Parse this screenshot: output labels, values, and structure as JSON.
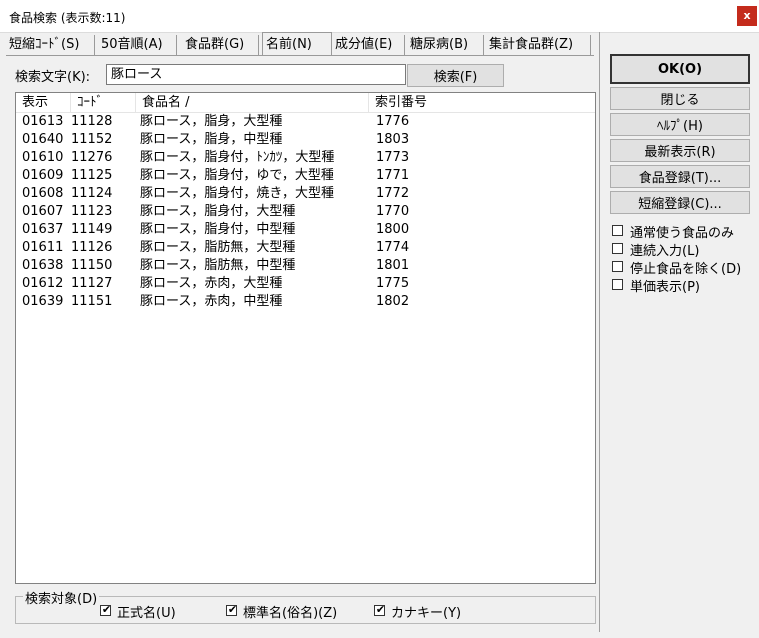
{
  "window": {
    "title": "食品検索 (表示数:11)",
    "close_glyph": "x"
  },
  "tabs": [
    {
      "label": "短縮ｺｰﾄﾞ(S)"
    },
    {
      "label": "50音順(A)"
    },
    {
      "label": "食品群(G)"
    },
    {
      "label": "名前(N)"
    },
    {
      "label": "成分値(E)"
    },
    {
      "label": "糖尿病(B)"
    },
    {
      "label": "集計食品群(Z)"
    }
  ],
  "active_tab": "名前(N)",
  "search": {
    "label": "検索文字(K):",
    "value": "豚ロース",
    "button_label": "検索(F)"
  },
  "table": {
    "columns": [
      "表示",
      "ｺｰﾄﾞ",
      "食品名 /",
      "索引番号"
    ],
    "rows": [
      [
        "01613",
        "11128",
        "豚ロース，脂身，大型種",
        "1776"
      ],
      [
        "01640",
        "11152",
        "豚ロース，脂身，中型種",
        "1803"
      ],
      [
        "01610",
        "11276",
        "豚ロース，脂身付，ﾄﾝｶﾂ，大型種",
        "1773"
      ],
      [
        "01609",
        "11125",
        "豚ロース，脂身付，ゆで，大型種",
        "1771"
      ],
      [
        "01608",
        "11124",
        "豚ロース，脂身付，焼き，大型種",
        "1772"
      ],
      [
        "01607",
        "11123",
        "豚ロース，脂身付，大型種",
        "1770"
      ],
      [
        "01637",
        "11149",
        "豚ロース，脂身付，中型種",
        "1800"
      ],
      [
        "01611",
        "11126",
        "豚ロース，脂肪無，大型種",
        "1774"
      ],
      [
        "01638",
        "11150",
        "豚ロース，脂肪無，中型種",
        "1801"
      ],
      [
        "01612",
        "11127",
        "豚ロース，赤肉，大型種",
        "1775"
      ],
      [
        "01639",
        "11151",
        "豚ロース，赤肉，中型種",
        "1802"
      ]
    ]
  },
  "search_target": {
    "legend": "検索対象(D)",
    "options": [
      {
        "label": "正式名(U)",
        "checked": true
      },
      {
        "label": "標準名(俗名)(Z)",
        "checked": true
      },
      {
        "label": "カナキー(Y)",
        "checked": true
      }
    ]
  },
  "side_buttons": [
    {
      "label": "OK(O)"
    },
    {
      "label": "閉じる"
    },
    {
      "label": "ﾍﾙﾌﾟ(H)"
    },
    {
      "label": "最新表示(R)"
    },
    {
      "label": "食品登録(T)..."
    },
    {
      "label": "短縮登録(C)..."
    }
  ],
  "side_options": [
    {
      "label": "通常使う食品のみ",
      "checked": false
    },
    {
      "label": "連続入力(L)",
      "checked": false
    },
    {
      "label": "停止食品を除く(D)",
      "checked": false
    },
    {
      "label": "単価表示(P)",
      "checked": false
    }
  ],
  "check_glyph": "✔"
}
